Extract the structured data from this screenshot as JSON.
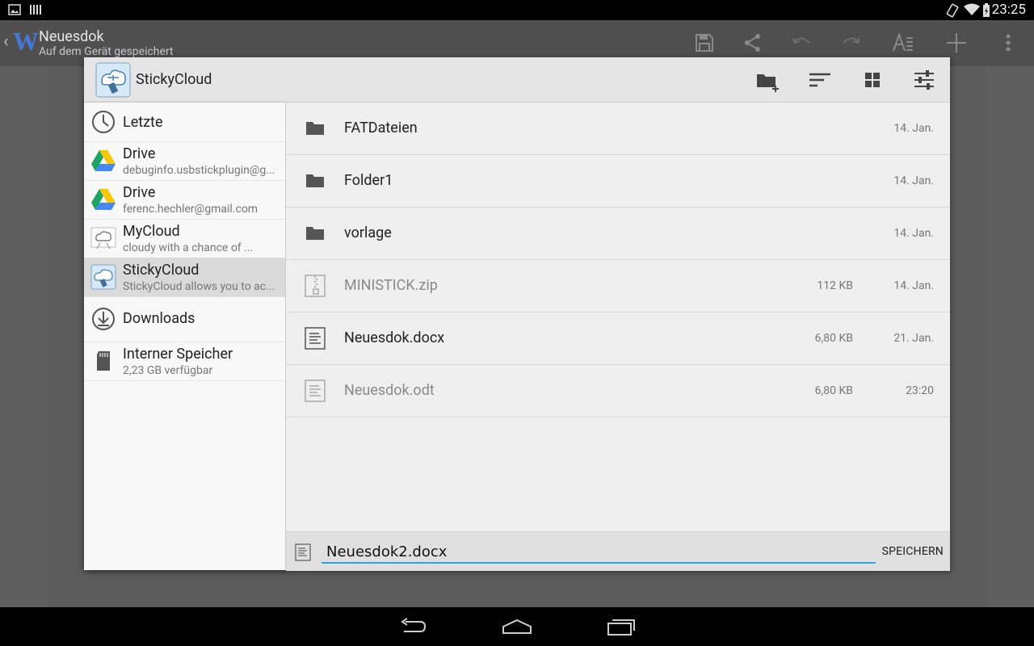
{
  "status_bar": {
    "time": "23:25"
  },
  "app_bar": {
    "title": "Neuesdok",
    "subtitle": "Auf dem Gerät gespeichert"
  },
  "dialog": {
    "title": "StickyCloud",
    "sidebar": [
      {
        "label": "Letzte",
        "sub": "",
        "icon": "clock-icon"
      },
      {
        "label": "Drive",
        "sub": "debuginfo.usbstickplugin@g...",
        "icon": "google-drive-icon"
      },
      {
        "label": "Drive",
        "sub": "ferenc.hechler@gmail.com",
        "icon": "google-drive-icon"
      },
      {
        "label": "MyCloud",
        "sub": "cloudy with a chance of ...",
        "icon": "mycloud-icon"
      },
      {
        "label": "StickyCloud",
        "sub": "StickyCloud allows you to ac...",
        "icon": "stickycloud-icon"
      },
      {
        "label": "Downloads",
        "sub": "",
        "icon": "download-icon"
      },
      {
        "label": "Interner Speicher",
        "sub": "2,23 GB verfügbar",
        "icon": "sd-card-icon"
      }
    ],
    "files": [
      {
        "name": "FATDateien",
        "size": "",
        "date": "14. Jan.",
        "type": "folder"
      },
      {
        "name": "Folder1",
        "size": "",
        "date": "14. Jan.",
        "type": "folder"
      },
      {
        "name": "vorlage",
        "size": "",
        "date": "14. Jan.",
        "type": "folder"
      },
      {
        "name": "MINISTICK.zip",
        "size": "112 KB",
        "date": "14. Jan.",
        "type": "zip"
      },
      {
        "name": "Neuesdok.docx",
        "size": "6,80 KB",
        "date": "21. Jan.",
        "type": "document"
      },
      {
        "name": "Neuesdok.odt",
        "size": "6,80 KB",
        "date": "23:20",
        "type": "document"
      }
    ],
    "save": {
      "filename": "Neuesdok2.docx",
      "button_label": "SPEICHERN"
    }
  },
  "colors": {
    "accent_underline": "#33a6d9",
    "active_item_bg": "#dadada"
  }
}
